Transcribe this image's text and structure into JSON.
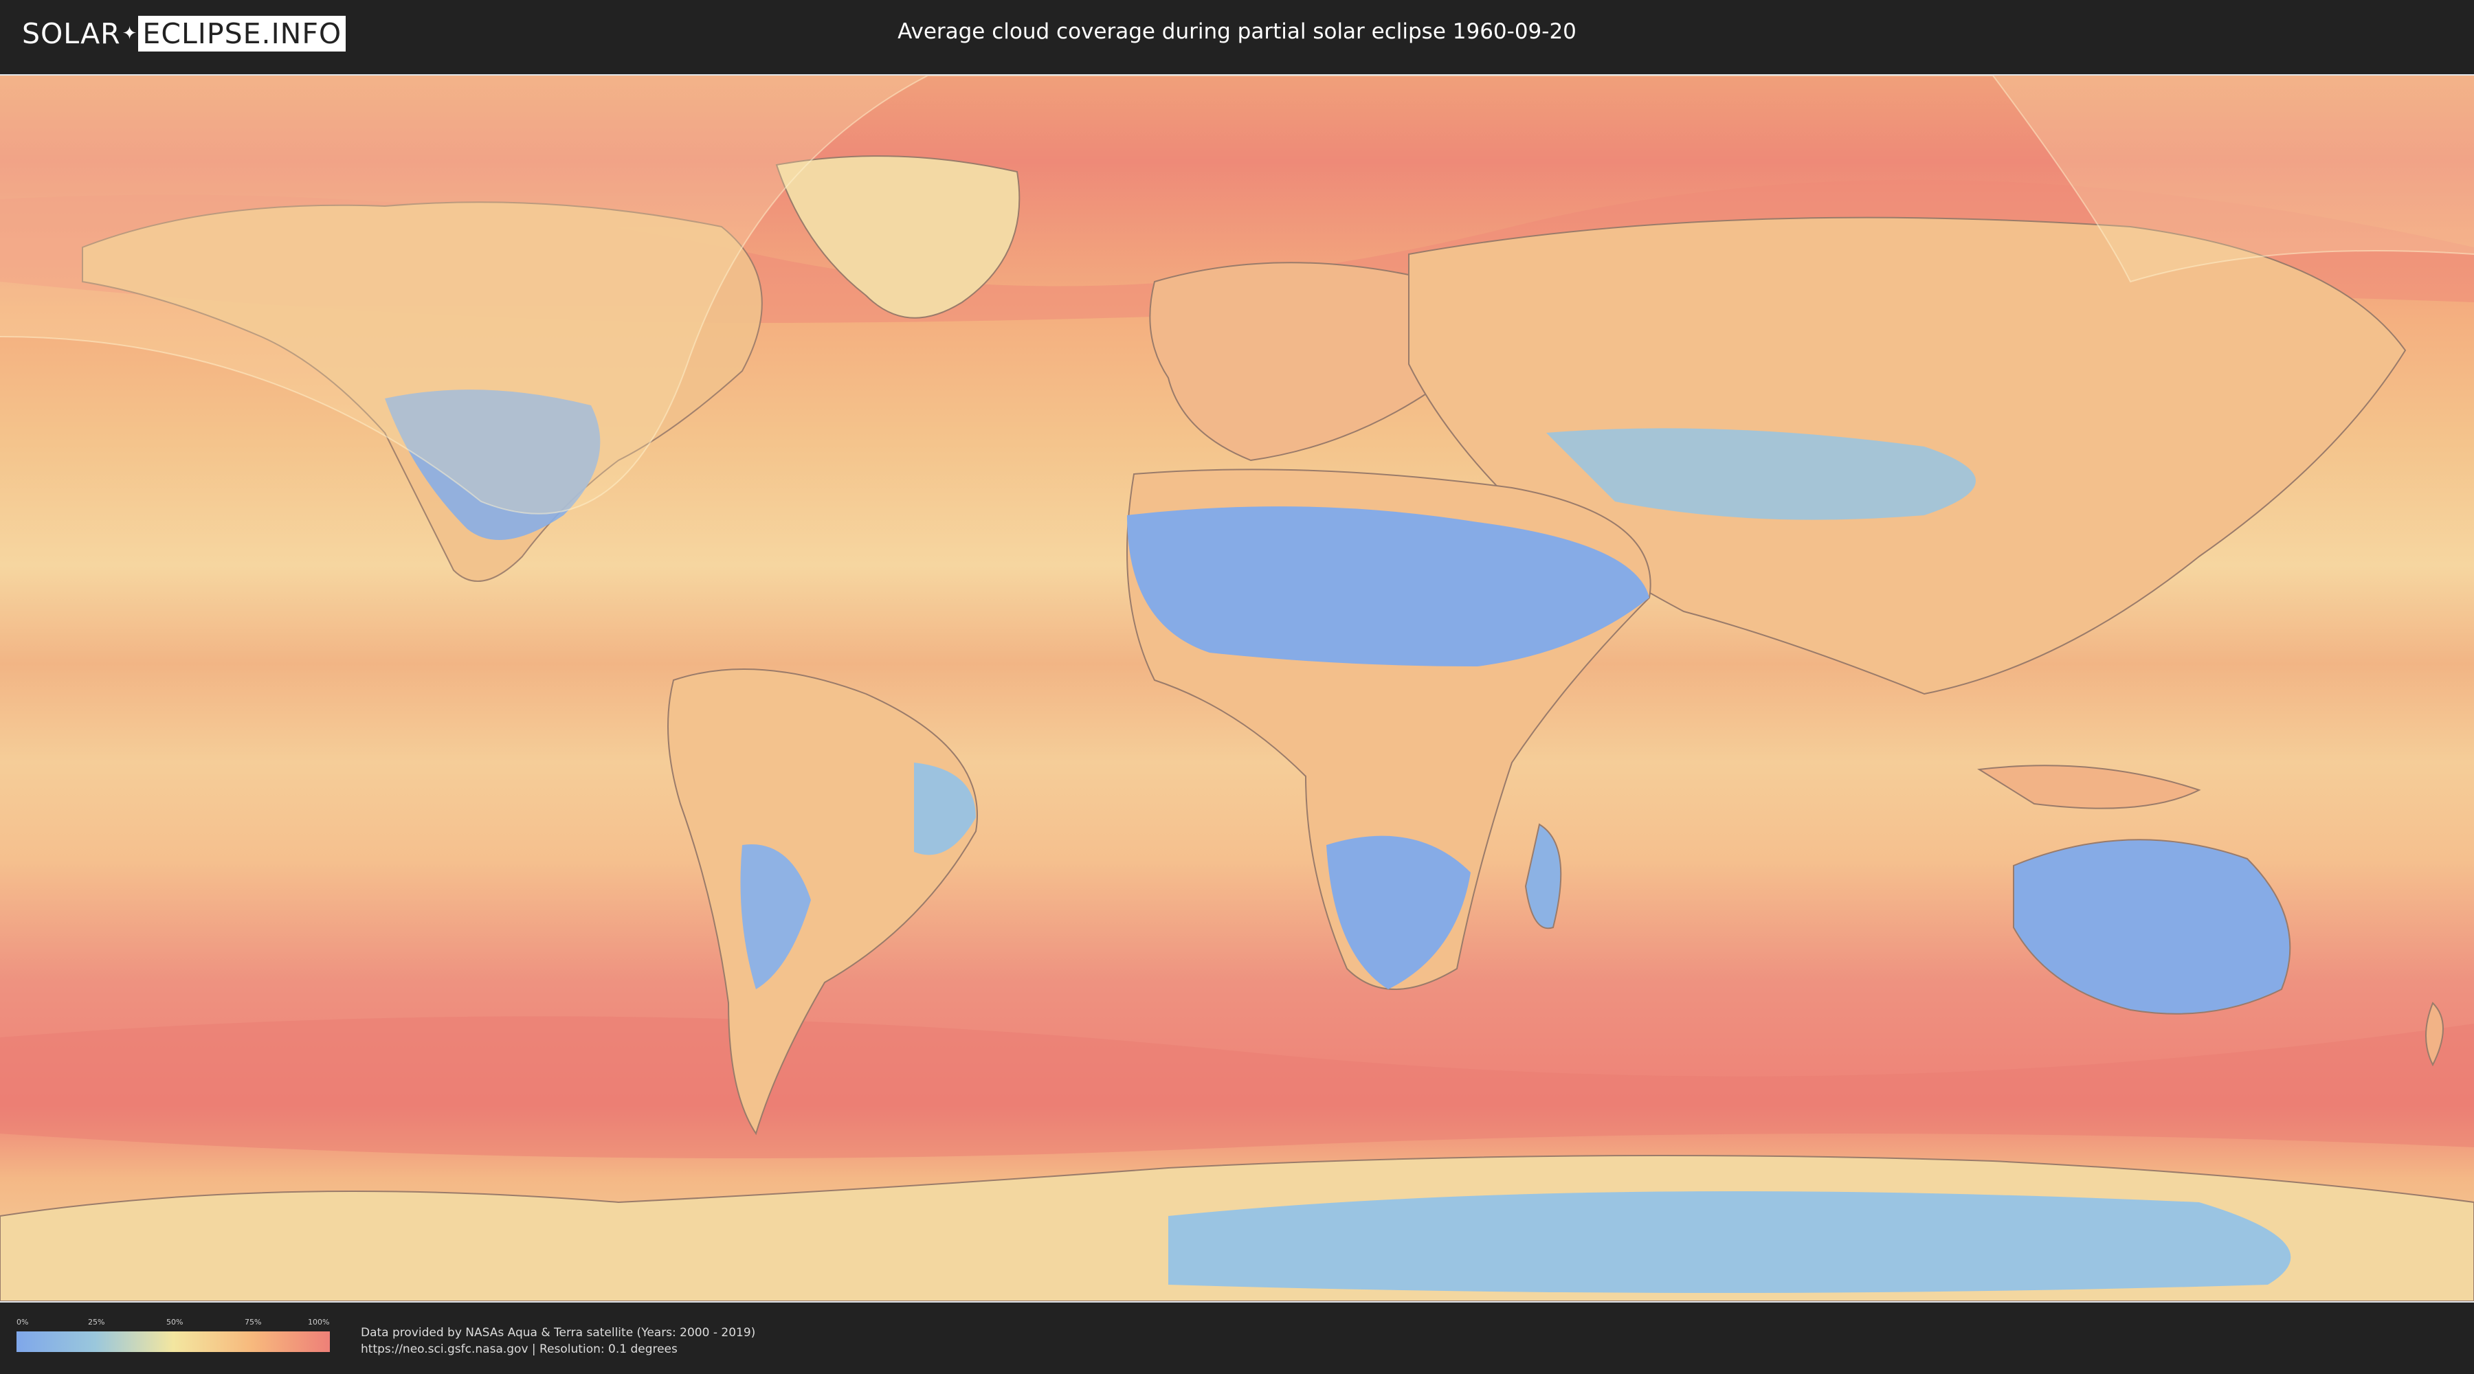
{
  "header": {
    "logo_part1": "SOLAR",
    "logo_part2": "ECLIPSE.INFO",
    "title": "Average cloud coverage during partial solar eclipse 1960-09-20"
  },
  "map": {
    "description_icon": "world-map-icon",
    "colors": {
      "clear": "#7fa7ea",
      "low": "#9ac7dc",
      "mid": "#f3e6a0",
      "high": "#f7b97d",
      "overcast": "#ee8078",
      "eclipse_overlay": "#fbe6b0"
    }
  },
  "legend": {
    "ticks": [
      "0%",
      "25%",
      "50%",
      "75%",
      "100%"
    ]
  },
  "credits": {
    "line1": "Data provided by NASAs Aqua & Terra satellite (Years: 2000 - 2019)",
    "line2": "https://neo.sci.gsfc.nasa.gov | Resolution: 0.1 degrees"
  }
}
